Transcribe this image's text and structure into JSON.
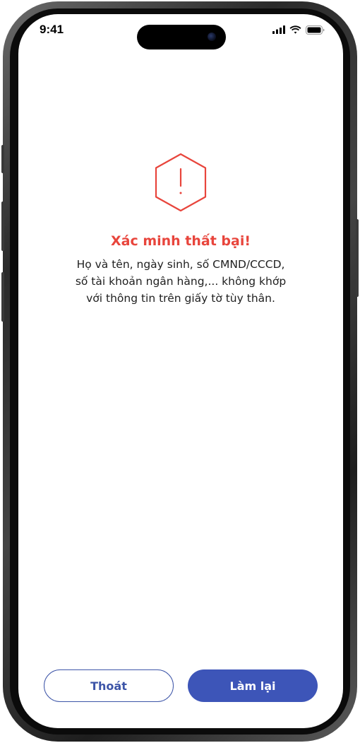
{
  "status_bar": {
    "time": "9:41",
    "icons": [
      "cellular-signal-icon",
      "wifi-icon",
      "battery-icon"
    ]
  },
  "dialog": {
    "icon": "warning-hexagon-icon",
    "title": "Xác minh thất bại!",
    "message_lines": [
      "Họ và tên, ngày sinh, số CMND/CCCD,",
      "số tài khoản ngân hàng,... không khớp",
      "với thông tin trên giấy tờ tùy thân."
    ]
  },
  "actions": {
    "exit_label": "Thoát",
    "retry_label": "Làm lại"
  },
  "colors": {
    "error": "#e8453c",
    "primary": "#3d55b8",
    "text": "#1f1f1f",
    "background": "#ffffff"
  }
}
